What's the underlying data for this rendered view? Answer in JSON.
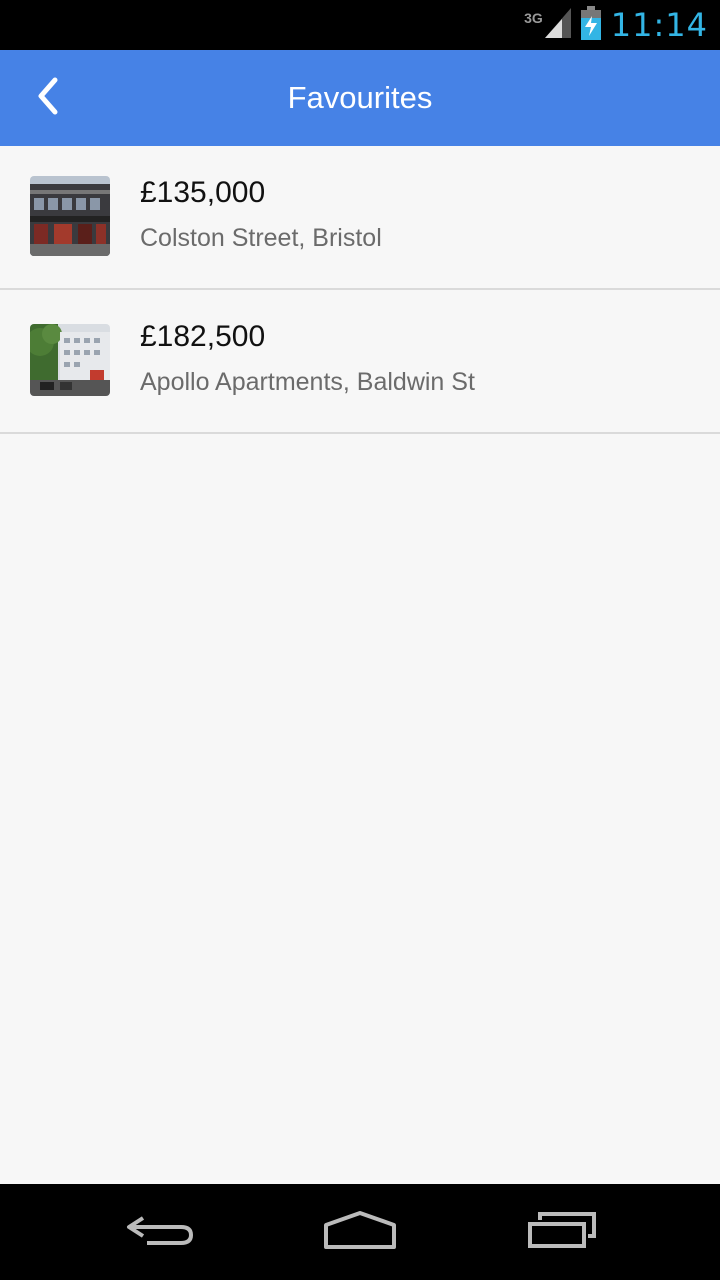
{
  "status_bar": {
    "network": "3G",
    "time": "11:14",
    "accent_color": "#33b5e5",
    "icons": [
      "signal-icon",
      "battery-charging-icon"
    ]
  },
  "action_bar": {
    "title": "Favourites",
    "background_color": "#4682e6",
    "back_icon": "chevron-left-icon"
  },
  "favourites": [
    {
      "price": "£135,000",
      "address": "Colston Street, Bristol"
    },
    {
      "price": "£182,500",
      "address": "Apollo Apartments, Baldwin St"
    }
  ],
  "nav_bar": {
    "icons": [
      "back-arrow-icon",
      "home-icon",
      "recent-apps-icon"
    ]
  }
}
